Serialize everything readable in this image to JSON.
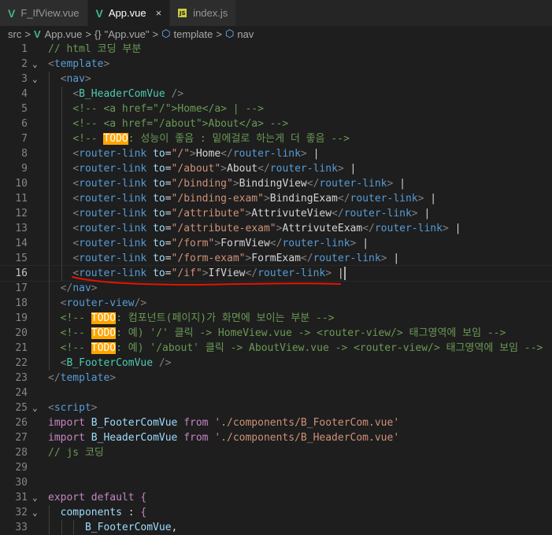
{
  "tabs": [
    {
      "label": "F_IfView.vue",
      "icon": "vue-icon",
      "active": false
    },
    {
      "label": "App.vue",
      "icon": "vue-icon",
      "active": true,
      "close": "×"
    },
    {
      "label": "index.js",
      "icon": "js-icon",
      "active": false,
      "badge": "JS"
    }
  ],
  "breadcrumb": {
    "items": [
      "src",
      "App.vue",
      "\"App.vue\"",
      "template",
      "nav"
    ],
    "braces": "{}",
    "separator": ">"
  },
  "editor": {
    "current_line": 16,
    "lines": [
      {
        "n": "1",
        "t": [
          [
            "cm",
            "// html 코딩 부분"
          ]
        ]
      },
      {
        "n": "2",
        "fold": true,
        "t": [
          [
            "tg",
            "<"
          ],
          [
            "tn",
            "template"
          ],
          [
            "tg",
            ">"
          ]
        ]
      },
      {
        "n": "3",
        "fold": true,
        "t": [
          [
            "tx",
            "  "
          ],
          [
            "tg",
            "<"
          ],
          [
            "tn",
            "nav"
          ],
          [
            "tg",
            ">"
          ]
        ]
      },
      {
        "n": "4",
        "t": [
          [
            "tx",
            "    "
          ],
          [
            "tg",
            "<"
          ],
          [
            "cls",
            "B_HeaderComVue"
          ],
          [
            "tx",
            " "
          ],
          [
            "tg",
            "/>"
          ]
        ]
      },
      {
        "n": "5",
        "t": [
          [
            "tx",
            "    "
          ],
          [
            "cm",
            "<!-- <a href=\"/\">Home</a> | -->"
          ]
        ]
      },
      {
        "n": "6",
        "t": [
          [
            "tx",
            "    "
          ],
          [
            "cm",
            "<!-- <a href=\"/about\">About</a> -->"
          ]
        ]
      },
      {
        "n": "7",
        "t": [
          [
            "tx",
            "    "
          ],
          [
            "cm",
            "<!-- "
          ],
          [
            "todo",
            "TODO"
          ],
          [
            "cm",
            ": 성능이 좋음 : 밑에걸로 하는게 더 좋음 -->"
          ]
        ]
      },
      {
        "n": "8",
        "t": [
          [
            "tx",
            "    "
          ],
          [
            "tg",
            "<"
          ],
          [
            "tn",
            "router-link"
          ],
          [
            "tx",
            " "
          ],
          [
            "at",
            "to"
          ],
          [
            "tx",
            "="
          ],
          [
            "st",
            "\"/\""
          ],
          [
            "tg",
            ">"
          ],
          [
            "tx",
            "Home"
          ],
          [
            "tg",
            "</"
          ],
          [
            "tn",
            "router-link"
          ],
          [
            "tg",
            ">"
          ],
          [
            "tx",
            " |"
          ]
        ]
      },
      {
        "n": "9",
        "t": [
          [
            "tx",
            "    "
          ],
          [
            "tg",
            "<"
          ],
          [
            "tn",
            "router-link"
          ],
          [
            "tx",
            " "
          ],
          [
            "at",
            "to"
          ],
          [
            "tx",
            "="
          ],
          [
            "st",
            "\"/about\""
          ],
          [
            "tg",
            ">"
          ],
          [
            "tx",
            "About"
          ],
          [
            "tg",
            "</"
          ],
          [
            "tn",
            "router-link"
          ],
          [
            "tg",
            ">"
          ],
          [
            "tx",
            " |"
          ]
        ]
      },
      {
        "n": "10",
        "t": [
          [
            "tx",
            "    "
          ],
          [
            "tg",
            "<"
          ],
          [
            "tn",
            "router-link"
          ],
          [
            "tx",
            " "
          ],
          [
            "at",
            "to"
          ],
          [
            "tx",
            "="
          ],
          [
            "st",
            "\"/binding\""
          ],
          [
            "tg",
            ">"
          ],
          [
            "tx",
            "BindingView"
          ],
          [
            "tg",
            "</"
          ],
          [
            "tn",
            "router-link"
          ],
          [
            "tg",
            ">"
          ],
          [
            "tx",
            " |"
          ]
        ]
      },
      {
        "n": "11",
        "t": [
          [
            "tx",
            "    "
          ],
          [
            "tg",
            "<"
          ],
          [
            "tn",
            "router-link"
          ],
          [
            "tx",
            " "
          ],
          [
            "at",
            "to"
          ],
          [
            "tx",
            "="
          ],
          [
            "st",
            "\"/binding-exam\""
          ],
          [
            "tg",
            ">"
          ],
          [
            "tx",
            "BindingExam"
          ],
          [
            "tg",
            "</"
          ],
          [
            "tn",
            "router-link"
          ],
          [
            "tg",
            ">"
          ],
          [
            "tx",
            " |"
          ]
        ]
      },
      {
        "n": "12",
        "t": [
          [
            "tx",
            "    "
          ],
          [
            "tg",
            "<"
          ],
          [
            "tn",
            "router-link"
          ],
          [
            "tx",
            " "
          ],
          [
            "at",
            "to"
          ],
          [
            "tx",
            "="
          ],
          [
            "st",
            "\"/attribute\""
          ],
          [
            "tg",
            ">"
          ],
          [
            "tx",
            "AttrivuteView"
          ],
          [
            "tg",
            "</"
          ],
          [
            "tn",
            "router-link"
          ],
          [
            "tg",
            ">"
          ],
          [
            "tx",
            " |"
          ]
        ]
      },
      {
        "n": "13",
        "t": [
          [
            "tx",
            "    "
          ],
          [
            "tg",
            "<"
          ],
          [
            "tn",
            "router-link"
          ],
          [
            "tx",
            " "
          ],
          [
            "at",
            "to"
          ],
          [
            "tx",
            "="
          ],
          [
            "st",
            "\"/attribute-exam\""
          ],
          [
            "tg",
            ">"
          ],
          [
            "tx",
            "AttrivuteExam"
          ],
          [
            "tg",
            "</"
          ],
          [
            "tn",
            "router-link"
          ],
          [
            "tg",
            ">"
          ],
          [
            "tx",
            " |"
          ]
        ]
      },
      {
        "n": "14",
        "t": [
          [
            "tx",
            "    "
          ],
          [
            "tg",
            "<"
          ],
          [
            "tn",
            "router-link"
          ],
          [
            "tx",
            " "
          ],
          [
            "at",
            "to"
          ],
          [
            "tx",
            "="
          ],
          [
            "st",
            "\"/form\""
          ],
          [
            "tg",
            ">"
          ],
          [
            "tx",
            "FormView"
          ],
          [
            "tg",
            "</"
          ],
          [
            "tn",
            "router-link"
          ],
          [
            "tg",
            ">"
          ],
          [
            "tx",
            " |"
          ]
        ]
      },
      {
        "n": "15",
        "t": [
          [
            "tx",
            "    "
          ],
          [
            "tg",
            "<"
          ],
          [
            "tn",
            "router-link"
          ],
          [
            "tx",
            " "
          ],
          [
            "at",
            "to"
          ],
          [
            "tx",
            "="
          ],
          [
            "st",
            "\"/form-exam\""
          ],
          [
            "tg",
            ">"
          ],
          [
            "tx",
            "FormExam"
          ],
          [
            "tg",
            "</"
          ],
          [
            "tn",
            "router-link"
          ],
          [
            "tg",
            ">"
          ],
          [
            "tx",
            " |"
          ]
        ]
      },
      {
        "n": "16",
        "t": [
          [
            "tx",
            "    "
          ],
          [
            "tg",
            "<"
          ],
          [
            "tn",
            "router-link"
          ],
          [
            "tx",
            " "
          ],
          [
            "at",
            "to"
          ],
          [
            "tx",
            "="
          ],
          [
            "st",
            "\"/if\""
          ],
          [
            "tg",
            ">"
          ],
          [
            "tx",
            "IfView"
          ],
          [
            "tg",
            "</"
          ],
          [
            "tn",
            "router-link"
          ],
          [
            "tg",
            ">"
          ],
          [
            "tx",
            " |"
          ],
          [
            "caret",
            ""
          ]
        ]
      },
      {
        "n": "17",
        "t": [
          [
            "tx",
            "  "
          ],
          [
            "tg",
            "</"
          ],
          [
            "tn",
            "nav"
          ],
          [
            "tg",
            ">"
          ]
        ]
      },
      {
        "n": "18",
        "t": [
          [
            "tx",
            "  "
          ],
          [
            "tg",
            "<"
          ],
          [
            "tn",
            "router-view"
          ],
          [
            "tg",
            "/>"
          ]
        ]
      },
      {
        "n": "19",
        "t": [
          [
            "tx",
            "  "
          ],
          [
            "cm",
            "<!-- "
          ],
          [
            "todo",
            "TODO"
          ],
          [
            "cm",
            ": 컴포넌트(페이지)가 화면에 보이는 부분 -->"
          ]
        ]
      },
      {
        "n": "20",
        "t": [
          [
            "tx",
            "  "
          ],
          [
            "cm",
            "<!-- "
          ],
          [
            "todo",
            "TODO"
          ],
          [
            "cm",
            ": 예) '/' 클릭 -> HomeView.vue -> <router-view/> 태그영역에 보임 -->"
          ]
        ]
      },
      {
        "n": "21",
        "t": [
          [
            "tx",
            "  "
          ],
          [
            "cm",
            "<!-- "
          ],
          [
            "todo",
            "TODO"
          ],
          [
            "cm",
            ": 예) '/about' 클릭 -> AboutView.vue -> <router-view/> 태그영역에 보임 -->"
          ]
        ]
      },
      {
        "n": "22",
        "t": [
          [
            "tx",
            "  "
          ],
          [
            "tg",
            "<"
          ],
          [
            "cls",
            "B_FooterComVue"
          ],
          [
            "tx",
            " "
          ],
          [
            "tg",
            "/>"
          ]
        ]
      },
      {
        "n": "23",
        "t": [
          [
            "tg",
            "</"
          ],
          [
            "tn",
            "template"
          ],
          [
            "tg",
            ">"
          ]
        ]
      },
      {
        "n": "24",
        "t": []
      },
      {
        "n": "25",
        "fold": true,
        "t": [
          [
            "tg",
            "<"
          ],
          [
            "tn",
            "script"
          ],
          [
            "tg",
            ">"
          ]
        ]
      },
      {
        "n": "26",
        "t": [
          [
            "kw",
            "import"
          ],
          [
            "tx",
            " "
          ],
          [
            "fn",
            "B_FooterComVue"
          ],
          [
            "tx",
            " "
          ],
          [
            "kw",
            "from"
          ],
          [
            "tx",
            " "
          ],
          [
            "st",
            "'./components/B_FooterCom.vue'"
          ]
        ]
      },
      {
        "n": "27",
        "t": [
          [
            "kw",
            "import"
          ],
          [
            "tx",
            " "
          ],
          [
            "fn",
            "B_HeaderComVue"
          ],
          [
            "tx",
            " "
          ],
          [
            "kw",
            "from"
          ],
          [
            "tx",
            " "
          ],
          [
            "st",
            "'./components/B_HeaderCom.vue'"
          ]
        ]
      },
      {
        "n": "28",
        "t": [
          [
            "cm",
            "// js 코딩"
          ]
        ]
      },
      {
        "n": "29",
        "t": []
      },
      {
        "n": "30",
        "t": []
      },
      {
        "n": "31",
        "fold": true,
        "t": [
          [
            "kw",
            "export"
          ],
          [
            "tx",
            " "
          ],
          [
            "kw",
            "default"
          ],
          [
            "tx",
            " "
          ],
          [
            "kw",
            "{"
          ]
        ]
      },
      {
        "n": "32",
        "fold": true,
        "t": [
          [
            "tx",
            "  "
          ],
          [
            "fn",
            "components"
          ],
          [
            "tx",
            " : "
          ],
          [
            "kw",
            "{"
          ]
        ]
      },
      {
        "n": "33",
        "t": [
          [
            "tx",
            "      "
          ],
          [
            "fn",
            "B_FooterComVue"
          ],
          [
            "tx",
            ","
          ]
        ]
      }
    ]
  },
  "annotation": {
    "color": "#e51400",
    "kind": "red-underline"
  }
}
